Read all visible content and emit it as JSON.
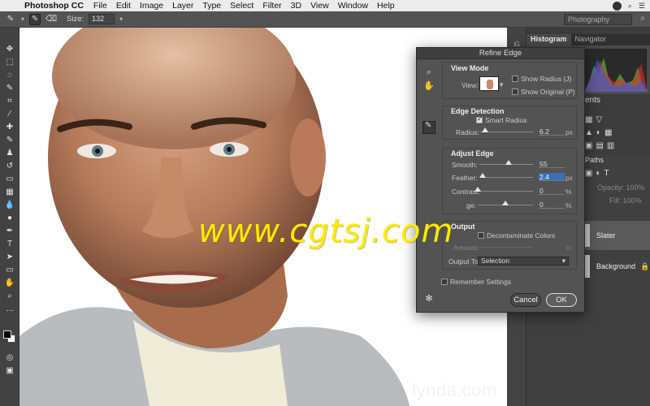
{
  "menubar": {
    "app": "Photoshop CC",
    "items": [
      "File",
      "Edit",
      "Image",
      "Layer",
      "Type",
      "Select",
      "Filter",
      "3D",
      "View",
      "Window",
      "Help"
    ]
  },
  "options": {
    "size_label": "Size:",
    "size_value": "132",
    "workspace": "Photography"
  },
  "dialog": {
    "title": "Refine Edge",
    "view_mode": {
      "heading": "View Mode",
      "view_label": "View:",
      "show_radius": "Show Radius (J)",
      "show_original": "Show Original (P)"
    },
    "edge_detection": {
      "heading": "Edge Detection",
      "smart_radius": "Smart Radius",
      "radius_label": "Radius:",
      "radius_value": "6.2",
      "radius_unit": "px",
      "radius_pos": 0.1
    },
    "adjust_edge": {
      "heading": "Adjust Edge",
      "smooth_label": "Smooth:",
      "smooth_value": "55",
      "smooth_pos": 0.55,
      "feather_label": "Feather:",
      "feather_value": "2.4",
      "feather_unit": "px",
      "feather_pos": 0.0,
      "contrast_label": "Contrast:",
      "contrast_value": "0",
      "contrast_unit": "%",
      "contrast_pos": 0.0,
      "shift_label": "ge:",
      "shift_value": "0",
      "shift_unit": "%",
      "shift_pos": 0.5
    },
    "output": {
      "heading": "Output",
      "decontaminate": "Decontaminate Colors",
      "amount_label": "Amount:",
      "amount_unit": "%",
      "output_to_label": "Output To:",
      "output_to_value": "Selection"
    },
    "remember": "Remember Settings",
    "cancel": "Cancel",
    "ok": "OK"
  },
  "panels": {
    "tabs": [
      "Histogram",
      "Navigator"
    ],
    "adjustments_tab": "ents",
    "layers_tab": "Paths",
    "opacity_label": "Opacity:",
    "opacity_value": "100%",
    "fill_label": "Fill:",
    "fill_value": "100%",
    "layers": [
      "Slater",
      "Background"
    ]
  },
  "watermark": "www.cgtsj.com",
  "brand": "lynda.com"
}
